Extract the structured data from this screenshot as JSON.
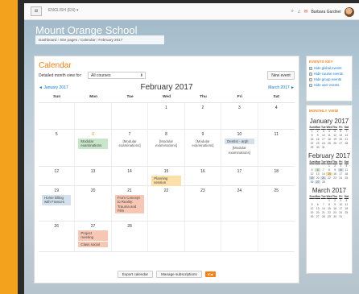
{
  "navbar": {
    "language": "ENGLISH (EN) ▾",
    "user_name": "Barbara Gardner",
    "menu_icon": "hamburger-icon",
    "search_icon": "search-icon",
    "bell_icon": "bell-icon",
    "mail_icon": "mail-icon"
  },
  "site_title": "Mount Orange School",
  "breadcrumb": [
    "Dashboard",
    "Site pages",
    "Calendar",
    "February 2017"
  ],
  "calendar": {
    "heading": "Calendar",
    "detail_label": "Detailed month view for:",
    "course_value": "All courses",
    "new_event": "New event",
    "prev_month": "◄ January 2017",
    "next_month": "March 2017 ►",
    "month_title": "February 2017",
    "days": [
      "Sun",
      "Mon",
      "Tue",
      "Wed",
      "Thu",
      "Fri",
      "Sat"
    ],
    "weeks": [
      [
        {
          "d": ""
        },
        {
          "d": ""
        },
        {
          "d": ""
        },
        {
          "d": "1"
        },
        {
          "d": "2"
        },
        {
          "d": "3"
        },
        {
          "d": "4"
        }
      ],
      [
        {
          "d": "5"
        },
        {
          "d": "6",
          "today": true,
          "events": [
            {
              "t": "Modular examinations",
              "c": "green"
            }
          ]
        },
        {
          "d": "7",
          "events": [
            {
              "t": "[Modular examinations]",
              "c": "plain"
            }
          ]
        },
        {
          "d": "8",
          "events": [
            {
              "t": "[Modular examinations]",
              "c": "plain"
            }
          ]
        },
        {
          "d": "9",
          "events": [
            {
              "t": "[Modular examinations]",
              "c": "plain"
            }
          ]
        },
        {
          "d": "10",
          "events": [
            {
              "t": "Dentist - argh",
              "c": "blue"
            },
            {
              "t": "[Modular examinations]",
              "c": "plainblue"
            }
          ]
        },
        {
          "d": "11"
        }
      ],
      [
        {
          "d": "12"
        },
        {
          "d": "13"
        },
        {
          "d": "14"
        },
        {
          "d": "15",
          "events": [
            {
              "t": "Planning session",
              "c": "yellow"
            }
          ]
        },
        {
          "d": "16"
        },
        {
          "d": "17"
        },
        {
          "d": "18"
        }
      ],
      [
        {
          "d": "19",
          "events": [
            {
              "t": "Home killing with Frances",
              "c": "blue"
            }
          ]
        },
        {
          "d": "20"
        },
        {
          "d": "21",
          "events": [
            {
              "t": "From Concept to Reality: Trauma and Film",
              "c": "salmon"
            }
          ]
        },
        {
          "d": "22"
        },
        {
          "d": "23"
        },
        {
          "d": "24"
        },
        {
          "d": "25"
        }
      ],
      [
        {
          "d": "26"
        },
        {
          "d": "27",
          "events": [
            {
              "t": "Project meeting",
              "c": "salmon"
            },
            {
              "t": "Class social",
              "c": "salmon"
            }
          ]
        },
        {
          "d": "28"
        },
        {
          "d": ""
        },
        {
          "d": ""
        },
        {
          "d": ""
        },
        {
          "d": ""
        }
      ]
    ],
    "export_label": "Export calendar",
    "manage_label": "Manage subscriptions",
    "ical_label": "iCal"
  },
  "events_key": {
    "title": "EVENTS KEY",
    "items": [
      {
        "label": "Hide global events",
        "color": "#c8e6c9"
      },
      {
        "label": "Hide course events",
        "color": "#f8c7b4"
      },
      {
        "label": "Hide group events",
        "color": "#fbe0a7"
      },
      {
        "label": "Hide user events",
        "color": "#d4e1ec"
      }
    ]
  },
  "monthly_view": {
    "title": "MONTHLY VIEW",
    "months": [
      {
        "name": "January 2017",
        "start": 0,
        "len": 31,
        "marks": {}
      },
      {
        "name": "February 2017",
        "start": 3,
        "len": 28,
        "marks": {
          "6": "e",
          "15": "t",
          "10": "c",
          "19": "c",
          "21": "c",
          "27": "c"
        }
      },
      {
        "name": "March 2017",
        "start": 3,
        "len": 31,
        "marks": {}
      }
    ],
    "dow": [
      "Sun",
      "Mon",
      "Tue",
      "Wed",
      "Thu",
      "Fri",
      "Sat"
    ]
  },
  "colors": {
    "accent": "#f98012",
    "link": "#1177d1"
  }
}
